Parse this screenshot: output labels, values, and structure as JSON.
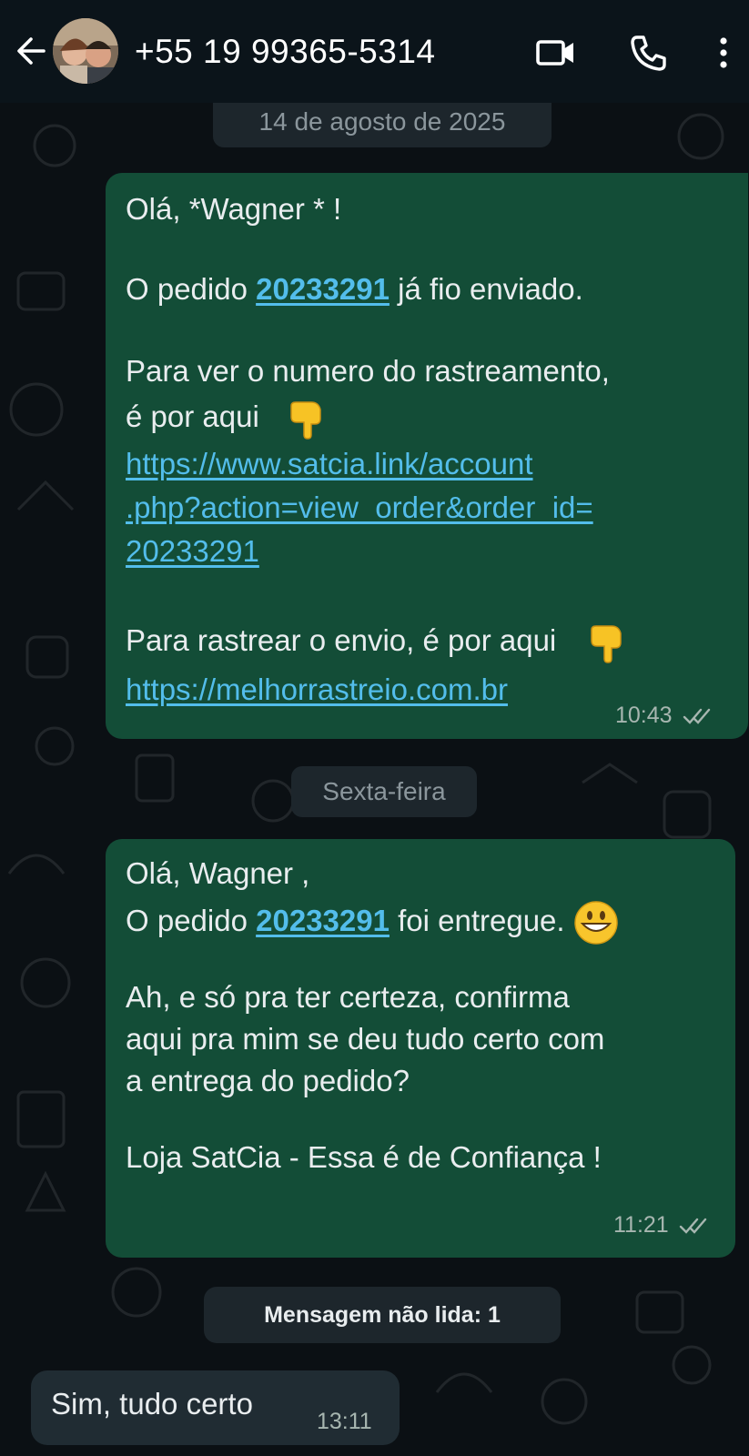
{
  "header": {
    "title": "+55 19 99365-5314"
  },
  "chips": {
    "date": "14 de agosto de 2025",
    "friday": "Sexta-feira",
    "unread": "Mensagem não lida: 1"
  },
  "message1": {
    "greeting": "Olá, *Wagner * !",
    "order_prefix": "O pedido ",
    "order_number": "20233291",
    "order_suffix": " já fio enviado.",
    "tracking_line1": "Para ver o numero do rastreamento,",
    "tracking_line2": "é por aqui",
    "link1_line1": "https://www.satcia.link/account",
    "link1_line2": ".php?action=view_order&order_id=",
    "link1_line3": "20233291",
    "track_text": "Para rastrear o envio, é por aqui",
    "link2": "https://melhorrastreio.com.br",
    "time": "10:43"
  },
  "message2": {
    "greeting": "Olá, Wagner ,",
    "order_prefix": "O pedido ",
    "order_number": "20233291",
    "order_suffix": " foi entregue.",
    "confirm_line1": "Ah, e só pra ter certeza, confirma",
    "confirm_line2": "aqui pra mim se deu tudo certo com",
    "confirm_line3": "a entrega do pedido?",
    "signature": "Loja SatCia - Essa é de Confiança !",
    "time": "11:21"
  },
  "message3": {
    "text": "Sim, tudo certo",
    "time": "13:11"
  },
  "icons": {
    "back": "arrow-left-icon",
    "video": "video-camera-icon",
    "call": "phone-icon",
    "more": "more-vertical-icon",
    "point_down": "backhand-index-pointing-down-emoji",
    "grin": "grinning-face-emoji",
    "read_ticks": "double-check-icon"
  },
  "colors": {
    "outgoing_bubble": "#134d37",
    "incoming_bubble": "#202c33",
    "link": "#53bdeb",
    "background": "#0b1014"
  }
}
